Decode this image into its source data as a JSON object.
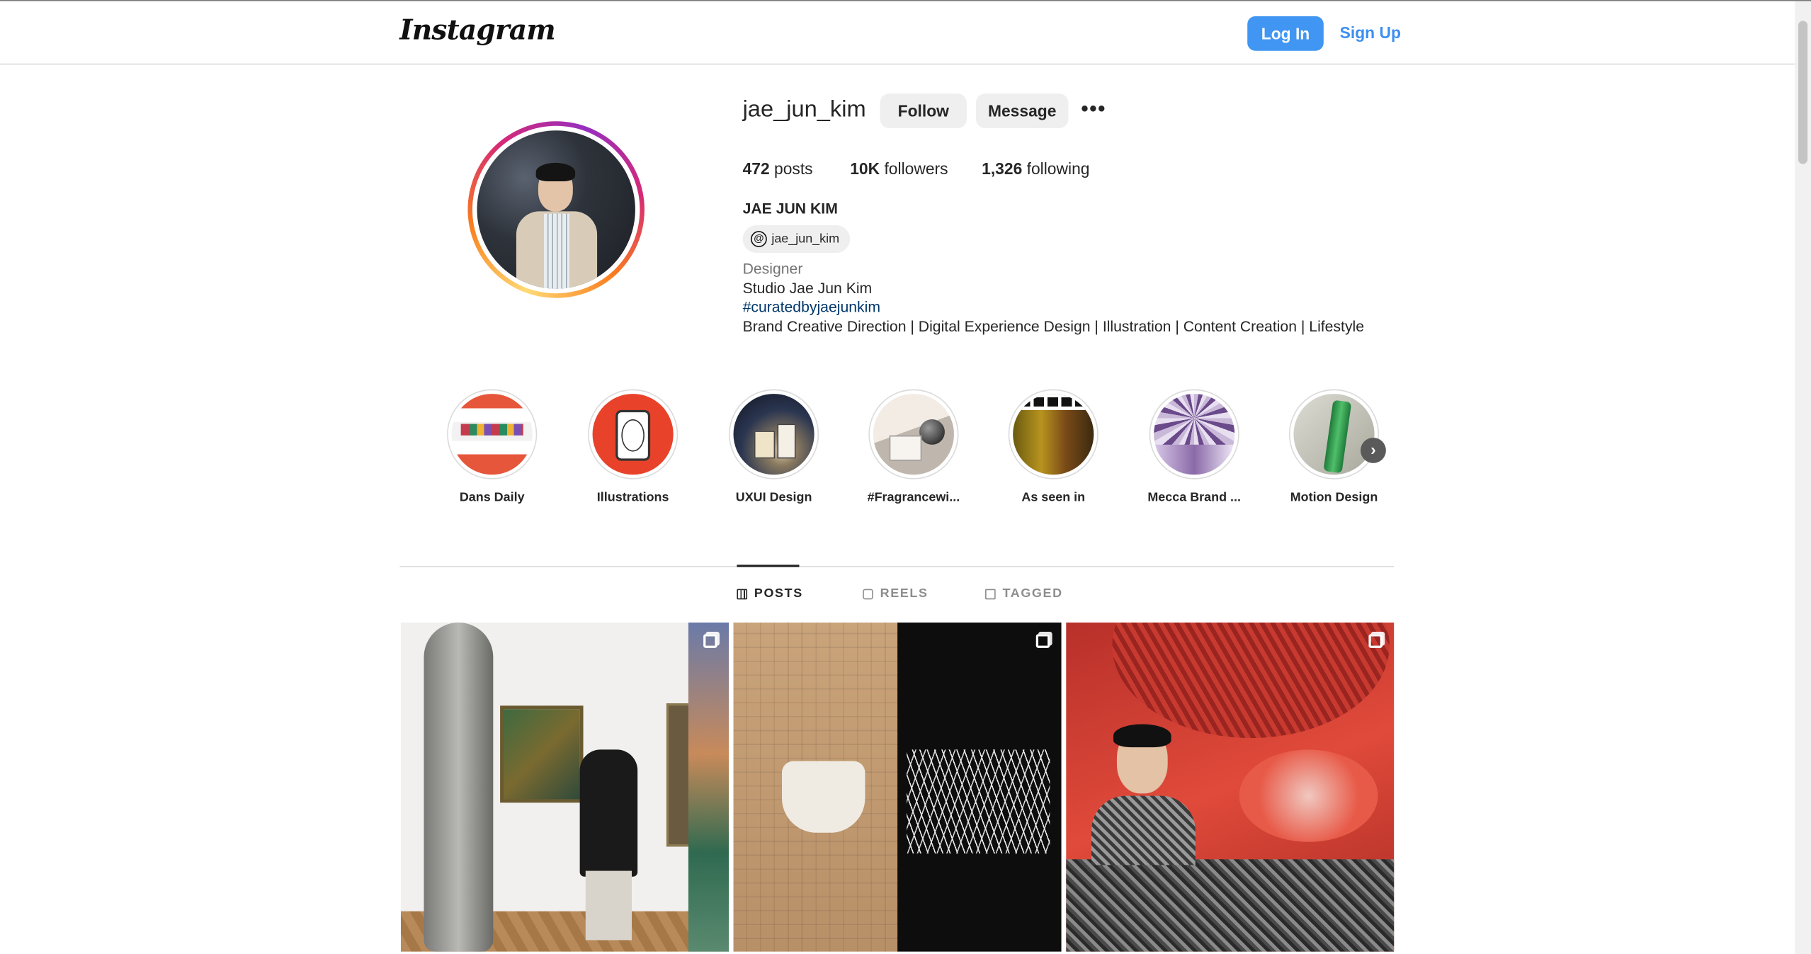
{
  "header": {
    "logo_text": "Instagram",
    "login_label": "Log In",
    "signup_label": "Sign Up"
  },
  "profile": {
    "username": "jae_jun_kim",
    "follow_label": "Follow",
    "message_label": "Message",
    "more_label": "•••",
    "stats": {
      "posts_count": "472",
      "posts_label": "posts",
      "followers_count": "10K",
      "followers_label": "followers",
      "following_count": "1,326",
      "following_label": "following"
    },
    "full_name": "JAE JUN KIM",
    "threads_handle": "jae_jun_kim",
    "bio": {
      "category": "Designer",
      "line2": "Studio Jae Jun Kim",
      "hashtag": "#curatedbyjaejunkim",
      "line4": "Brand Creative Direction | Digital Experience Design | Illustration | Content Creation | Lifestyle"
    }
  },
  "highlights": [
    {
      "label": "Dans Daily"
    },
    {
      "label": "Illustrations"
    },
    {
      "label": "UXUI Design"
    },
    {
      "label": "#Fragrancewi..."
    },
    {
      "label": "As seen in"
    },
    {
      "label": "Mecca Brand ..."
    },
    {
      "label": "Motion Design"
    }
  ],
  "tabs": [
    {
      "label": "POSTS",
      "active": true
    },
    {
      "label": "REELS",
      "active": false
    },
    {
      "label": "TAGGED",
      "active": false
    }
  ],
  "colors": {
    "primary_button": "#4096f2",
    "link": "#3d8ff0",
    "hashtag": "#00376b"
  }
}
